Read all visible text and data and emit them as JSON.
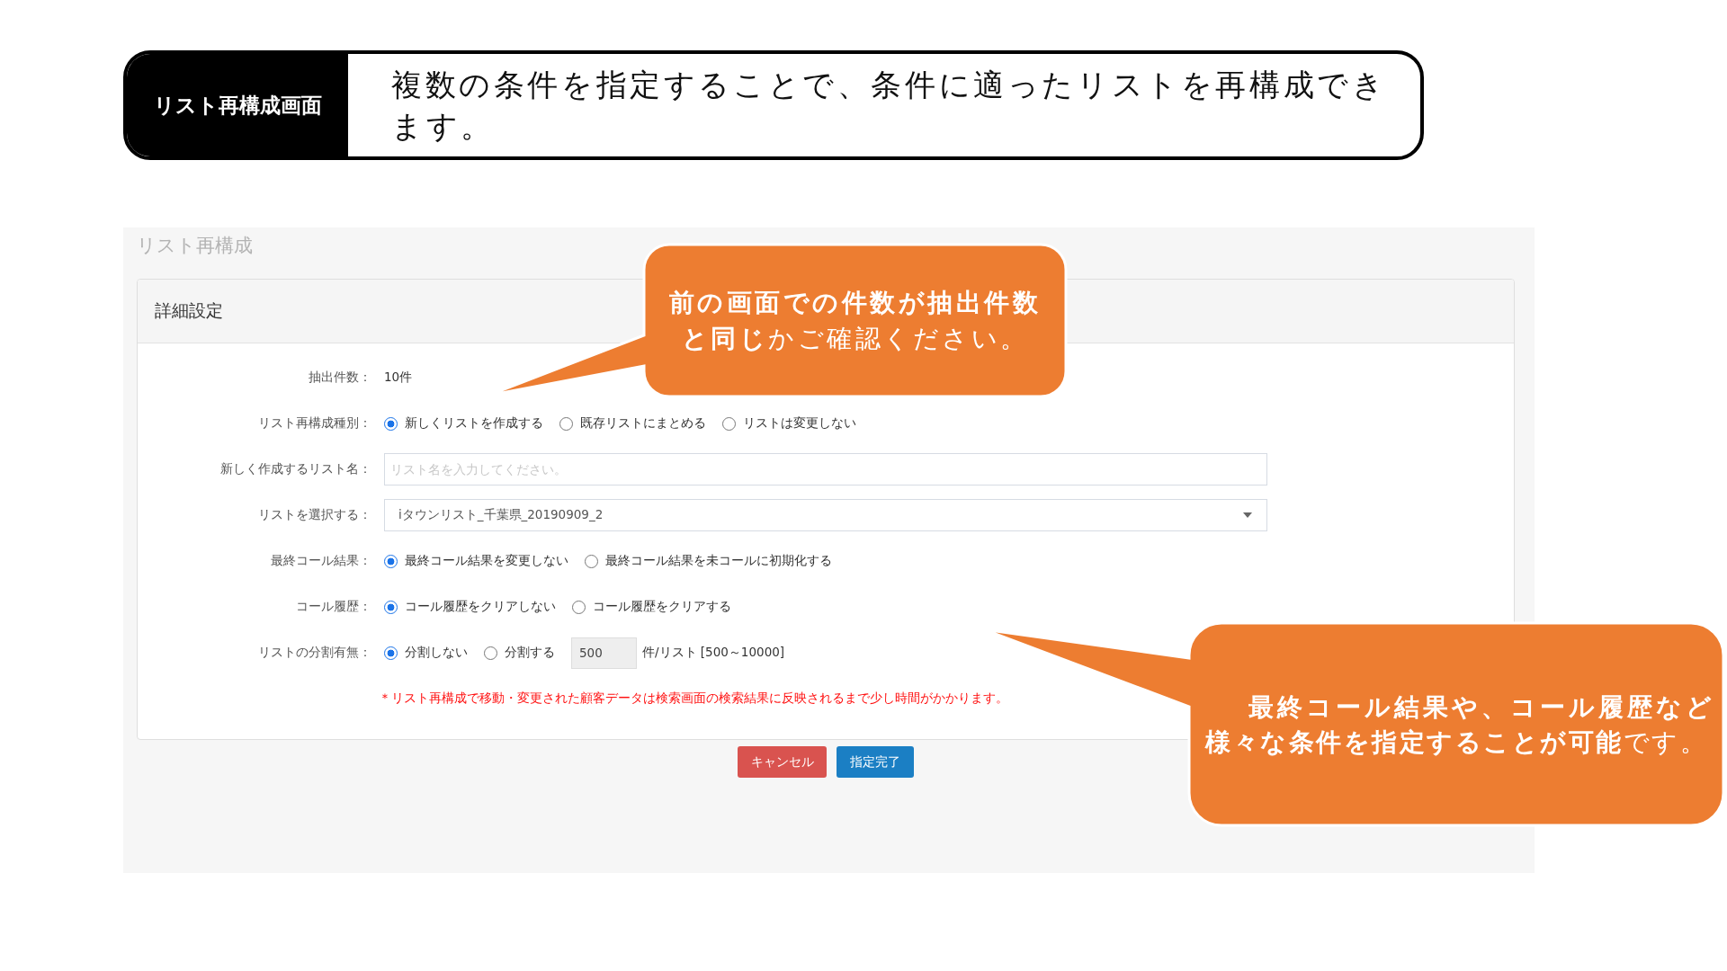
{
  "header": {
    "label": "リスト再構成画面",
    "description": "複数の条件を指定することで、条件に適ったリストを再構成できます。"
  },
  "panel": {
    "title": "リスト再構成",
    "card": {
      "title": "詳細設定",
      "rows": [
        {
          "kind": "text",
          "label": "抽出件数：",
          "value": "10件"
        },
        {
          "kind": "radio",
          "label": "リスト再構成種別：",
          "options": [
            {
              "label": "新しくリストを作成する",
              "selected": true
            },
            {
              "label": "既存リストにまとめる",
              "selected": false
            },
            {
              "label": "リストは変更しない",
              "selected": false
            }
          ]
        },
        {
          "kind": "input",
          "label": "新しく作成するリスト名：",
          "placeholder": "リスト名を入力してください。"
        },
        {
          "kind": "select",
          "label": "リストを選択する：",
          "value": "iタウンリスト_千葉県_20190909_2"
        },
        {
          "kind": "radio",
          "label": "最終コール結果：",
          "options": [
            {
              "label": "最終コール結果を変更しない",
              "selected": true
            },
            {
              "label": "最終コール結果を未コールに初期化する",
              "selected": false
            }
          ]
        },
        {
          "kind": "radio",
          "label": "コール履歴：",
          "options": [
            {
              "label": "コール履歴をクリアしない",
              "selected": true
            },
            {
              "label": "コール履歴をクリアする",
              "selected": false
            }
          ]
        },
        {
          "kind": "split",
          "label": "リストの分割有無：",
          "options": [
            {
              "label": "分割しない",
              "selected": true
            },
            {
              "label": "分割する",
              "selected": false
            }
          ],
          "count": "500",
          "suffix": "件/リスト [500～10000]"
        }
      ],
      "note": "＊リスト再構成で移動・変更された顧客データは検索画面の検索結果に反映されるまで少し時間がかかります。"
    },
    "buttons": [
      {
        "kind": "cancel",
        "label": "キャンセル"
      },
      {
        "kind": "primary",
        "label": "指定完了"
      }
    ]
  },
  "callouts": [
    {
      "text": "**前の画面での件数が抽出件数と同じ**かご確認ください。"
    },
    {
      "text": "**最終コール結果や、コール履歴など様々な条件を指定することが可能**です。"
    }
  ]
}
